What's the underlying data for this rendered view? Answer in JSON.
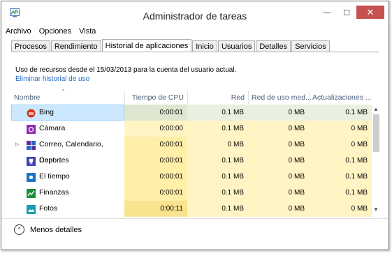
{
  "title": "Administrador de tareas",
  "window_controls": {
    "minimize": "—",
    "maximize": "☐",
    "close": "✕"
  },
  "menu": [
    "Archivo",
    "Opciones",
    "Vista"
  ],
  "tabs": [
    "Procesos",
    "Rendimiento",
    "Historial de aplicaciones",
    "Inicio",
    "Usuarios",
    "Detalles",
    "Servicios"
  ],
  "active_tab": "Historial de aplicaciones",
  "info_text": "Uso de recursos desde el 15/03/2013 para la cuenta del usuario actual.",
  "info_link": "Eliminar historial de uso",
  "columns": [
    "Nombre",
    "Tiempo de CPU",
    "Red",
    "Red de uso med...",
    "Actualizaciones ..."
  ],
  "sort_indicator": "^",
  "rows": [
    {
      "name": "Bing",
      "cpu": "0:00:01",
      "red": "0.1 MB",
      "red_med": "0 MB",
      "act": "0.1 MB",
      "icon": "bing-icon",
      "icon_color": "#d3371b",
      "selected": true,
      "expandable": false
    },
    {
      "name": "Cámara",
      "cpu": "0:00:00",
      "red": "0.1 MB",
      "red_med": "0 MB",
      "act": "0 MB",
      "icon": "camera-icon",
      "icon_color": "#8e2bb0",
      "selected": false,
      "expandable": false
    },
    {
      "name": "Correo, Calendario, Cont...",
      "cpu": "0:00:01",
      "red": "0 MB",
      "red_med": "0 MB",
      "act": "0 MB",
      "icon": "mail-calendar-icon",
      "icon_color": "#5b2d9b",
      "selected": false,
      "expandable": true
    },
    {
      "name": "Deportes",
      "cpu": "0:00:01",
      "red": "0.1 MB",
      "red_med": "0 MB",
      "act": "0.1 MB",
      "icon": "trophy-icon",
      "icon_color": "#3c3fb8",
      "selected": false,
      "expandable": false
    },
    {
      "name": "El tiempo",
      "cpu": "0:00:01",
      "red": "0.1 MB",
      "red_med": "0 MB",
      "act": "0.1 MB",
      "icon": "weather-icon",
      "icon_color": "#1e73c8",
      "selected": false,
      "expandable": false
    },
    {
      "name": "Finanzas",
      "cpu": "0:00:01",
      "red": "0.1 MB",
      "red_med": "0 MB",
      "act": "0.1 MB",
      "icon": "finance-icon",
      "icon_color": "#1b8c3a",
      "selected": false,
      "expandable": false
    },
    {
      "name": "Fotos",
      "cpu": "0:00:11",
      "red": "0.1 MB",
      "red_med": "0 MB",
      "act": "0 MB",
      "icon": "photos-icon",
      "icon_color": "#1b9bb0",
      "selected": false,
      "expandable": false
    }
  ],
  "footer_label": "Menos detalles",
  "colors": {
    "selected_row": "#cce8ff",
    "heat_light": "#fff4c4",
    "heat_medium": "#ffefa8",
    "heat_strong": "#f9e38e",
    "link": "#1f66c1"
  }
}
